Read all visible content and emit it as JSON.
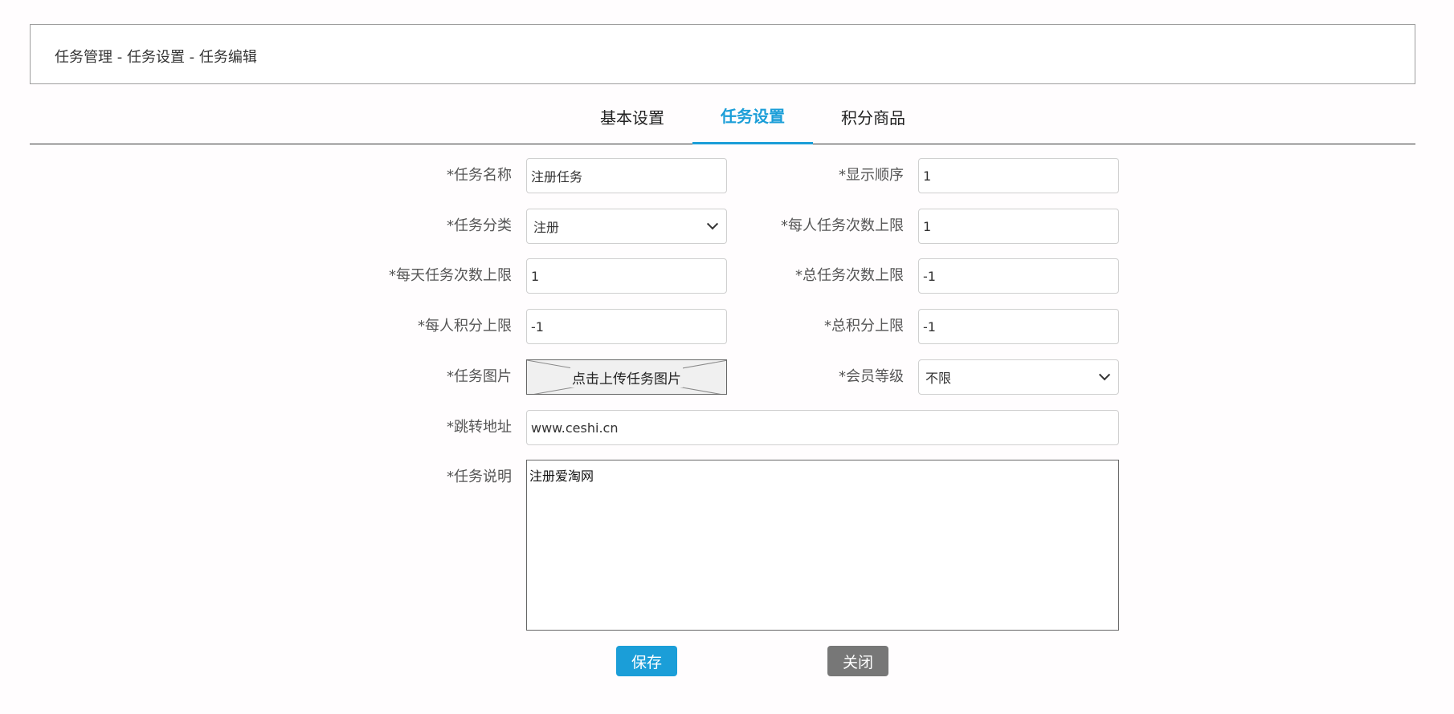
{
  "breadcrumb": "任务管理 - 任务设置 - 任务编辑",
  "tabs": {
    "basic": "基本设置",
    "task": "任务设置",
    "goods": "积分商品"
  },
  "form": {
    "task_name": {
      "label": "*任务名称",
      "value": "注册任务"
    },
    "display_order": {
      "label": "*显示顺序",
      "value": "1"
    },
    "task_category": {
      "label": "*任务分类",
      "value": "注册"
    },
    "per_person_limit": {
      "label": "*每人任务次数上限",
      "value": "1"
    },
    "daily_limit": {
      "label": "*每天任务次数上限",
      "value": "1"
    },
    "total_limit": {
      "label": "*总任务次数上限",
      "value": "-1"
    },
    "per_person_points": {
      "label": "*每人积分上限",
      "value": "-1"
    },
    "total_points": {
      "label": "*总积分上限",
      "value": "-1"
    },
    "task_image": {
      "label": "*任务图片",
      "upload_text": "点击上传任务图片"
    },
    "member_level": {
      "label": "*会员等级",
      "value": "不限"
    },
    "redirect_url": {
      "label": "*跳转地址",
      "value": "www.ceshi.cn"
    },
    "description": {
      "label": "*任务说明",
      "value": "注册爱淘网"
    }
  },
  "buttons": {
    "save": "保存",
    "close": "关闭"
  },
  "colors": {
    "accent": "#1b9ed8",
    "close_button": "#777777"
  }
}
